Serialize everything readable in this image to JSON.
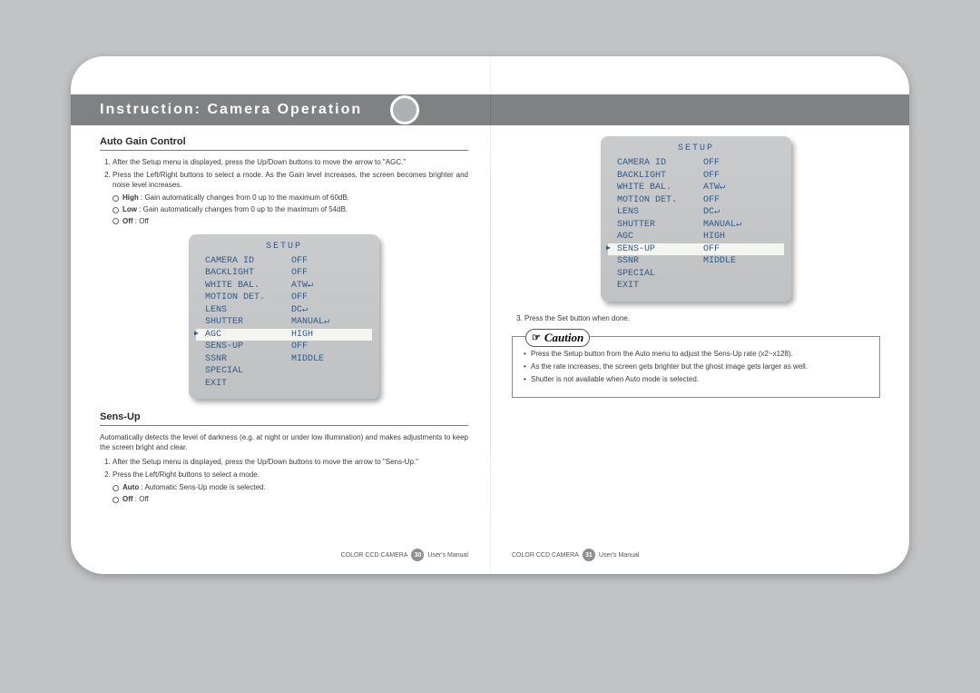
{
  "chapter_title": "Instruction: Camera Operation",
  "agc": {
    "heading": "Auto Gain Control",
    "steps": [
      "After the Setup menu is displayed, press the Up/Down buttons to move the arrow to \"AGC.\"",
      "Press the Left/Right buttons to select a mode. As the Gain level increases, the screen becomes brighter and noise level increases."
    ],
    "options": [
      {
        "name": "High",
        "desc": ": Gain automatically changes from 0 up to the maximum of 60dB."
      },
      {
        "name": "Low",
        "desc": ": Gain automatically changes from 0 up to the maximum of 54dB."
      },
      {
        "name": "Off",
        "desc": ": Off"
      }
    ]
  },
  "menu1": {
    "title": "SETUP",
    "rows": [
      {
        "k": "CAMERA ID",
        "v": "OFF"
      },
      {
        "k": "BACKLIGHT",
        "v": "OFF"
      },
      {
        "k": "WHITE BAL.",
        "v": "ATW↵"
      },
      {
        "k": "MOTION DET.",
        "v": "OFF"
      },
      {
        "k": "LENS",
        "v": "DC↵"
      },
      {
        "k": "SHUTTER",
        "v": "MANUAL↵"
      },
      {
        "k": "AGC",
        "v": "HIGH",
        "hl": true
      },
      {
        "k": "SENS-UP",
        "v": "OFF"
      },
      {
        "k": "SSNR",
        "v": "MIDDLE"
      },
      {
        "k": "SPECIAL",
        "v": ""
      },
      {
        "k": "EXIT",
        "v": ""
      }
    ]
  },
  "sensup": {
    "heading": "Sens-Up",
    "intro": "Automatically detects the level of darkness (e.g. at night or under low illumination) and makes adjustments to keep the screen bright and clear.",
    "steps": [
      "After the Setup menu is displayed, press the Up/Down buttons to move the arrow to \"Sens-Up.\"",
      "Press the Left/Right buttons to select a mode."
    ],
    "options": [
      {
        "name": "Auto",
        "desc": ": Automatic Sens-Up mode is selected."
      },
      {
        "name": "Off",
        "desc": ": Off"
      }
    ]
  },
  "menu2": {
    "title": "SETUP",
    "rows": [
      {
        "k": "CAMERA ID",
        "v": "OFF"
      },
      {
        "k": "BACKLIGHT",
        "v": "OFF"
      },
      {
        "k": "WHITE BAL.",
        "v": "ATW↵"
      },
      {
        "k": "MOTION DET.",
        "v": "OFF"
      },
      {
        "k": "LENS",
        "v": "DC↵"
      },
      {
        "k": "SHUTTER",
        "v": "MANUAL↵"
      },
      {
        "k": "AGC",
        "v": "HIGH"
      },
      {
        "k": "SENS-UP",
        "v": "OFF",
        "hl": true
      },
      {
        "k": "SSNR",
        "v": "MIDDLE"
      },
      {
        "k": "SPECIAL",
        "v": ""
      },
      {
        "k": "EXIT",
        "v": ""
      }
    ]
  },
  "step3": "Press the Set button when done.",
  "caution": {
    "label": "Caution",
    "items": [
      "Press the Setup button from the Auto menu to adjust the Sens-Up rate (x2~x128).",
      "As the rate increases, the screen gets brighter but the ghost image gets larger as well.",
      "Shutter is not available when Auto mode is selected."
    ]
  },
  "footer": {
    "product": "COLOR CCD CAMERA",
    "manual": "User's Manual",
    "page_left": "30",
    "page_right": "31"
  }
}
